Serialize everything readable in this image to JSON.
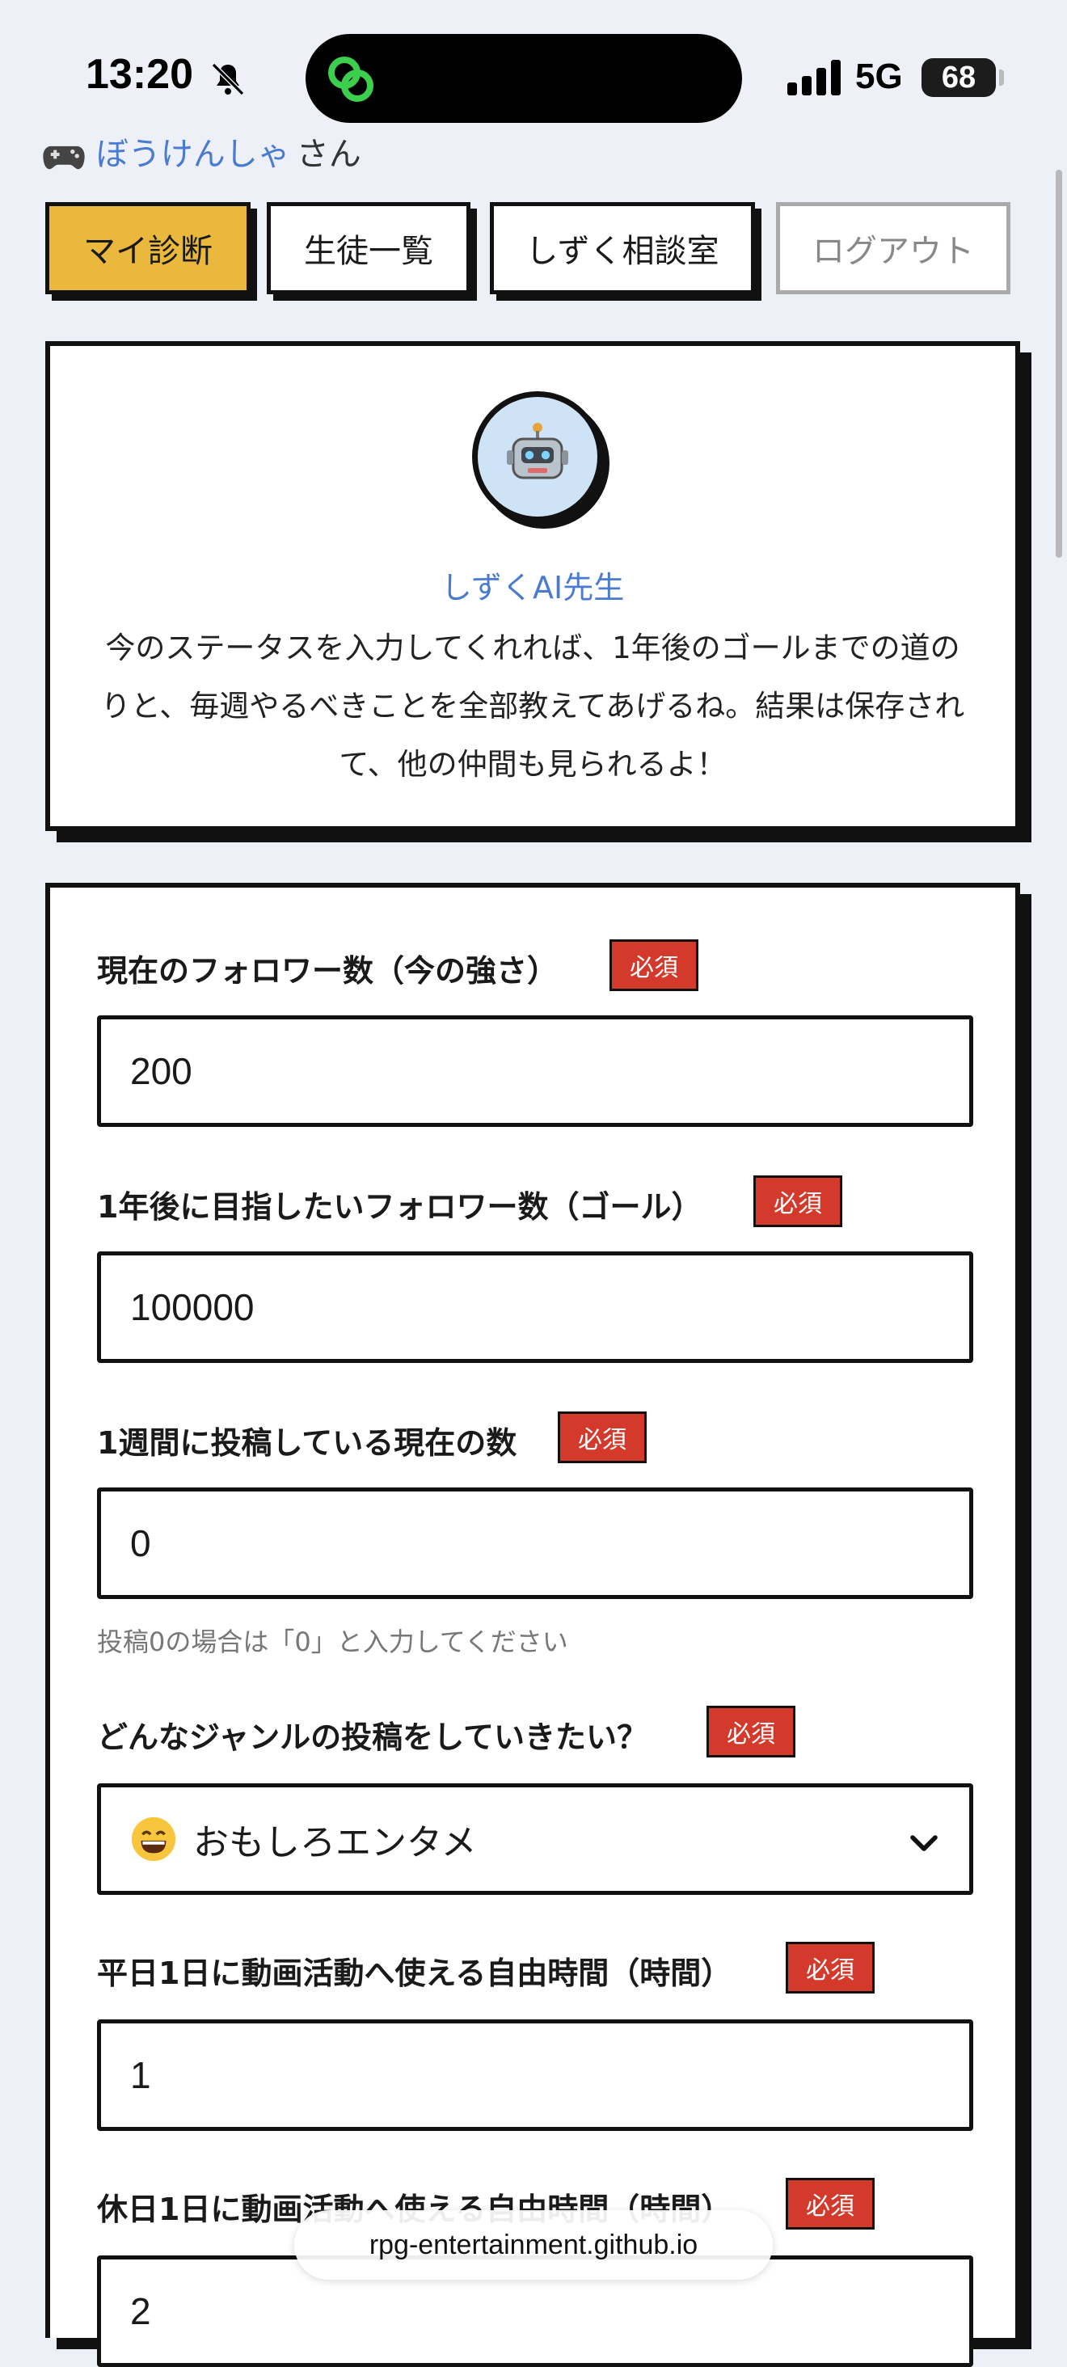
{
  "status": {
    "time": "13:20",
    "network": "5G",
    "battery": "68"
  },
  "user": {
    "name": "ぼうけんしゃ",
    "suffix": "さん"
  },
  "nav": {
    "my_diagnosis": "マイ診断",
    "students": "生徒一覧",
    "consult": "しずく相談室",
    "logout": "ログアウト"
  },
  "teacher": {
    "name": "しずくAI先生",
    "message": "今のステータスを入力してくれれば、1年後のゴールまでの道のりと、毎週やるべきことを全部教えてあげるね。結果は保存されて、他の仲間も見られるよ！"
  },
  "form": {
    "required_label": "必須",
    "fields": [
      {
        "label": "現在のフォロワー数（今の強さ）",
        "value": "200"
      },
      {
        "label": "1年後に目指したいフォロワー数（ゴール）",
        "value": "100000"
      },
      {
        "label": "1週間に投稿している現在の数",
        "value": "0",
        "hint": "投稿0の場合は「0」と入力してください"
      },
      {
        "label": "どんなジャンルの投稿をしていきたい？",
        "value": "おもしろエンタメ"
      },
      {
        "label": "平日1日に動画活動へ使える自由時間（時間）",
        "value": "1"
      },
      {
        "label": "休日1日に動画活動へ使える自由時間（時間）",
        "value": "2"
      }
    ]
  },
  "browser": {
    "url": "rpg-entertainment.github.io"
  },
  "colors": {
    "accent_yellow": "#e9b83c",
    "required_red": "#d33a2c",
    "link_blue": "#4a7bd0"
  }
}
